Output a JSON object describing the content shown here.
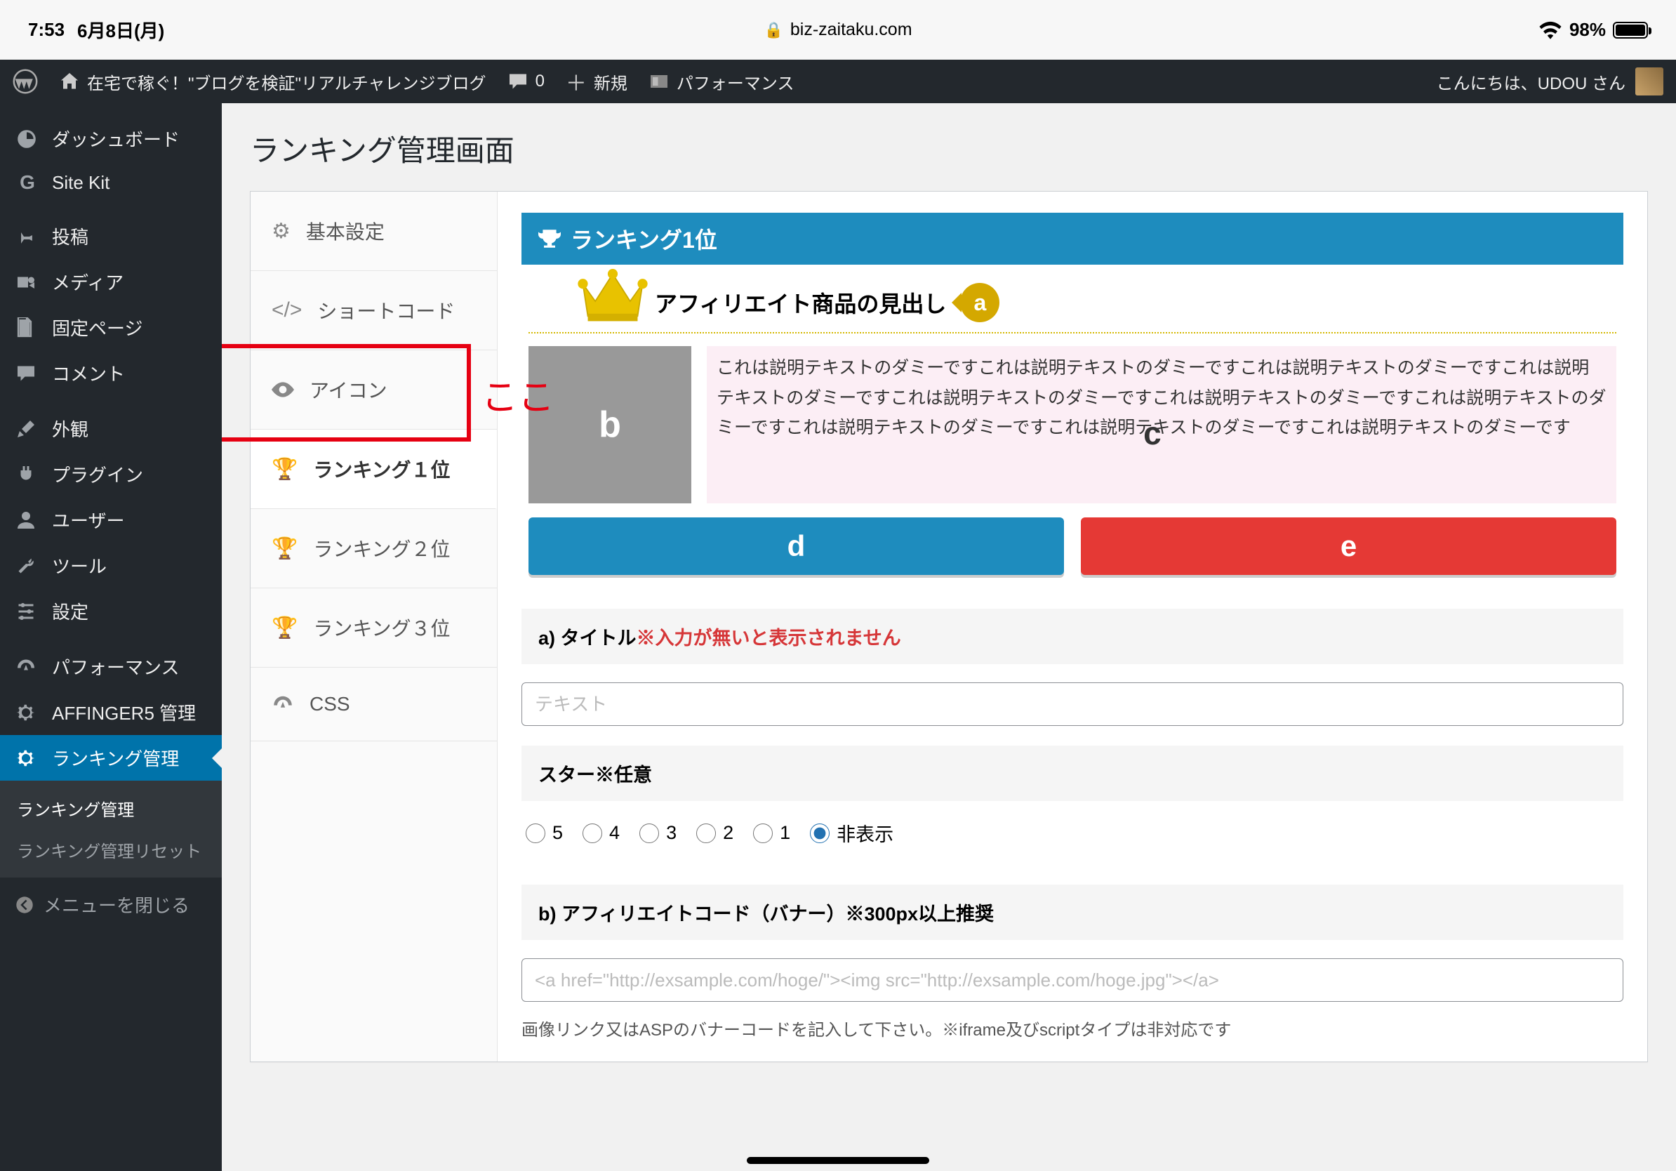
{
  "ios": {
    "time": "7:53",
    "date": "6月8日(月)",
    "url": "biz-zaitaku.com",
    "battery_pct": "98%"
  },
  "adminbar": {
    "site_name": "在宅で稼ぐ！\"ブログを検証\"リアルチャレンジブログ",
    "comments": "0",
    "new": "新規",
    "performance": "パフォーマンス",
    "greeting": "こんにちは、UDOU さん"
  },
  "sidebar": {
    "items": [
      {
        "label": "ダッシュボード"
      },
      {
        "label": "Site Kit"
      },
      {
        "label": "投稿"
      },
      {
        "label": "メディア"
      },
      {
        "label": "固定ページ"
      },
      {
        "label": "コメント"
      },
      {
        "label": "外観"
      },
      {
        "label": "プラグイン"
      },
      {
        "label": "ユーザー"
      },
      {
        "label": "ツール"
      },
      {
        "label": "設定"
      },
      {
        "label": "パフォーマンス"
      },
      {
        "label": "AFFINGER5 管理"
      },
      {
        "label": "ランキング管理"
      }
    ],
    "submenu": {
      "a": "ランキング管理",
      "b": "ランキング管理リセット"
    },
    "collapse": "メニューを閉じる"
  },
  "page": {
    "title": "ランキング管理画面"
  },
  "tabs": {
    "basic": "基本設定",
    "shortcode": "ショートコード",
    "icon": "アイコン",
    "rank1": "ランキング１位",
    "rank2": "ランキング２位",
    "rank3": "ランキング３位",
    "css": "CSS"
  },
  "annotation": {
    "here": "ここ"
  },
  "preview": {
    "header": "ランキング1位",
    "title": "アフィリエイト商品の見出し",
    "badge": "a",
    "img_label": "b",
    "desc": "これは説明テキストのダミーですこれは説明テキストのダミーですこれは説明テキストのダミーですこれは説明テキストのダミーですこれは説明テキストのダミーですこれは説明テキストのダミーですこれは説明テキストのダミーですこれは説明テキストのダミーですこれは説明テキストのダミーですこれは説明テキストのダミーです",
    "desc_marker": "c",
    "btn_d": "d",
    "btn_e": "e"
  },
  "form": {
    "a_label": "a) タイトル",
    "a_req": "※入力が無いと表示されません",
    "a_placeholder": "テキスト",
    "star_label": "スター※任意",
    "stars": [
      "5",
      "4",
      "3",
      "2",
      "1"
    ],
    "star_hide": "非表示",
    "b_label": "b) アフィリエイトコード（バナー）※300px以上推奨",
    "b_placeholder": "<a href=\"http://exsample.com/hoge/\"><img src=\"http://exsample.com/hoge.jpg\"></a>",
    "b_hint": "画像リンク又はASPのバナーコードを記入して下さい。※iframe及びscriptタイプは非対応です"
  }
}
